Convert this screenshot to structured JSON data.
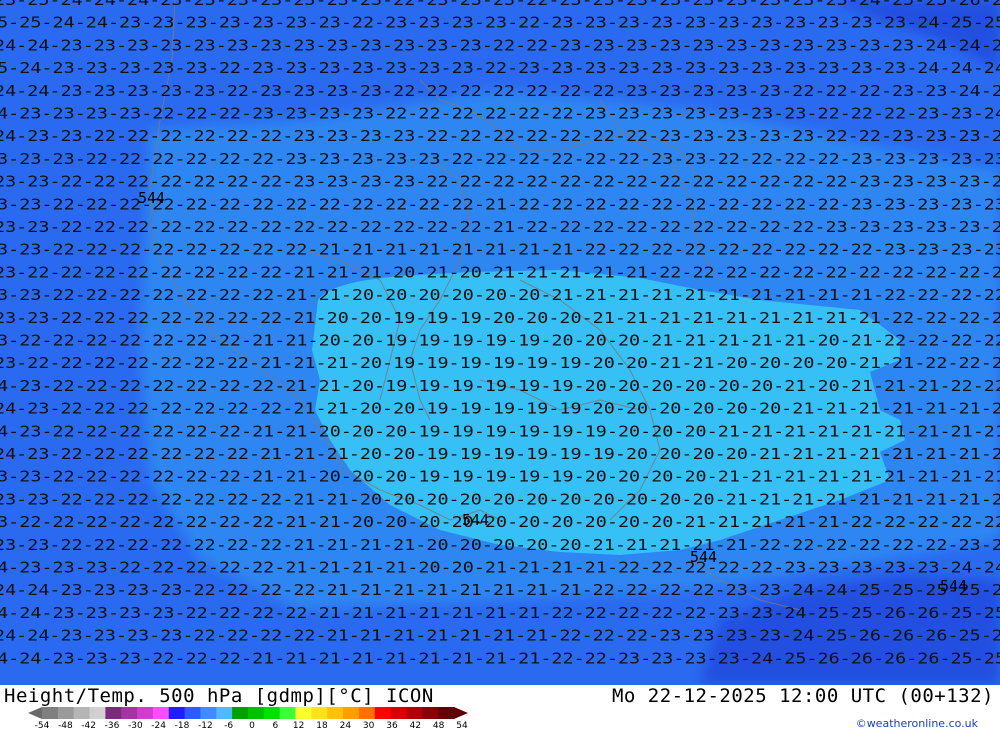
{
  "title": {
    "left": "Height/Temp. 500 hPa [gdmp][°C] ICON",
    "right": "Mo 22-12-2025 12:00 UTC (00+132)"
  },
  "credit": "©weatheronline.co.uk",
  "legend": {
    "ticks": [
      "-54",
      "-48",
      "-42",
      "-36",
      "-30",
      "-24",
      "-18",
      "-12",
      "-6",
      "0",
      "6",
      "12",
      "18",
      "24",
      "30",
      "36",
      "42",
      "48",
      "54"
    ],
    "colors": [
      "#7f7f7f",
      "#9a9a9a",
      "#b5b5b5",
      "#d0d0d0",
      "#7d2a7d",
      "#a533a5",
      "#cf3dcf",
      "#ff4cff",
      "#1e1eff",
      "#2b5cff",
      "#3e8cff",
      "#52b8ff",
      "#00a000",
      "#00c000",
      "#00e000",
      "#3cff3c",
      "#ffff30",
      "#ffe020",
      "#ffc010",
      "#ffa000",
      "#ff7000",
      "#ff0000",
      "#d80000",
      "#b00000",
      "#880000",
      "#600000"
    ]
  },
  "map": {
    "colors": {
      "outer": "#2a6af0",
      "mid": "#2f86f3",
      "core": "#36c0f5",
      "deep": "#2350e0"
    },
    "height_label": "544",
    "rows": [
      "23-25-24-24-24-23-23-23-23-23-23-23-22-23-23-23-22-23-23-23-23-23-23-23-23-23-24-25-25-26-26",
      "25-25-24-24-23-23-23-23-23-23-23-22-23-23-23-23-22-23-23-23-23-23-23-23-23-23-23-23-24-25-25",
      "24-24-23-23-23-23-23-23-23-23-23-23-23-23-23-22-22-23-23-23-23-23-23-23-23-23-23-23-24-24-25",
      "25-24-23-23-23-23-23-22-23-23-23-23-23-23-23-22-23-23-23-23-23-23-23-23-23-23-23-23-24-24-24",
      "24-24-23-23-23-23-23-22-23-23-23-23-22-22-22-22-22-22-22-23-23-23-23-23-22-22-22-23-23-24-24",
      "24-23-23-23-23-22-22-22-23-23-23-23-22-22-22-22-22-22-23-23-23-23-23-23-23-22-22-22-23-23-24",
      "24-23-23-22-22-22-22-22-22-23-23-23-23-22-22-22-22-22-22-22-23-23-23-23-23-22-22-23-23-23-24",
      "23-23-23-22-22-22-22-22-22-23-23-23-23-23-22-22-22-22-22-22-23-23-22-22-22-22-23-23-23-23-23",
      "23-23-22-22-22-22-22-22-22-23-23-23-23-22-22-22-22-22-22-22-22-22-22-22-22-22-23-23-23-23-23",
      "23-23-22-22-22-22-22-22-22-22-22-22-22-22-22-21-22-22-22-22-22-22-22-22-22-22-23-23-23-23-23",
      "23-23-22-22-22-22-22-22-22-22-22-22-22-22-22-21-22-22-22-22-22-22-22-22-22-23-23-23-23-23-23",
      "23-23-22-22-22-22-22-22-22-22-21-21-21-21-21-21-21-21-22-22-22-22-22-22-22-22-22-23-23-23-23",
      "23-22-22-22-22-22-22-22-22-21-21-21-20-21-20-21-21-21-21-21-22-22-22-22-22-22-22-22-22-22-22",
      "23-23-22-22-22-22-22-22-22-21-21-20-20-20-20-20-20-21-21-21-21-21-21-21-21-21-21-22-22-22-22",
      "23-23-22-22-22-22-22-22-22-21-20-20-19-19-19-20-20-20-21-21-21-21-21-21-21-21-21-22-22-22-22",
      "23-22-22-22-22-22-22-22-21-21-20-20-19-19-19-19-19-20-20-20-21-21-21-21-21-20-21-22-22-22-22",
      "23-22-22-22-22-22-22-22-21-21-21-20-19-19-19-19-19-19-20-20-21-21-20-20-20-20-21-21-22-22-22",
      "24-23-22-22-22-22-22-22-22-21-21-20-19-19-19-19-19-19-20-20-20-20-20-20-21-20-21-21-21-22-22",
      "24-23-22-22-22-22-22-22-22-21-21-20-20-19-19-19-19-19-20-20-20-20-20-20-21-21-21-21-21-21-21",
      "24-23-22-22-22-22-22-22-21-21-20-20-20-19-19-19-19-19-19-20-20-20-21-21-21-21-21-21-21-21-21",
      "24-23-22-22-22-22-22-22-21-21-21-20-20-19-19-19-19-19-19-20-20-20-20-21-21-21-21-21-21-21-21",
      "23-23-22-22-22-22-22-22-21-21-20-20-20-19-19-19-19-19-20-20-20-20-21-21-21-21-21-21-21-21-21",
      "23-23-22-22-22-22-22-22-22-21-21-20-20-20-20-20-20-20-20-20-20-20-21-21-21-21-21-21-21-21-21",
      "23-22-22-22-22-22-22-22-22-21-21-20-20-20-20-20-20-20-20-20-20-21-21-21-21-21-22-22-22-22-22",
      "23-23-22-22-22-22-22-22-22-21-21-21-21-20-20-20-20-20-21-21-21-21-21-22-22-22-22-22-22-23-23",
      "24-23-23-23-22-22-22-22-22-21-21-21-21-20-20-21-21-21-21-22-22-22-22-22-23-23-23-23-23-24-24",
      "24-24-23-23-23-23-22-22-22-22-21-21-21-21-21-21-21-21-22-22-22-22-23-23-24-24-25-25-25-25-25",
      "24-24-23-23-23-23-22-22-22-22-21-21-21-21-21-21-21-22-22-22-22-22-23-23-24-25-25-26-26-25-25",
      "24-24-23-23-23-23-22-22-22-22-21-21-21-21-21-21-21-22-22-22-23-23-23-23-24-25-26-26-26-25-25",
      "24-24-23-23-23-22-22-22-21-21-21-21-21-21-21-21-21-22-22-23-23-23-23-24-25-26-26-26-26-25-25"
    ]
  }
}
